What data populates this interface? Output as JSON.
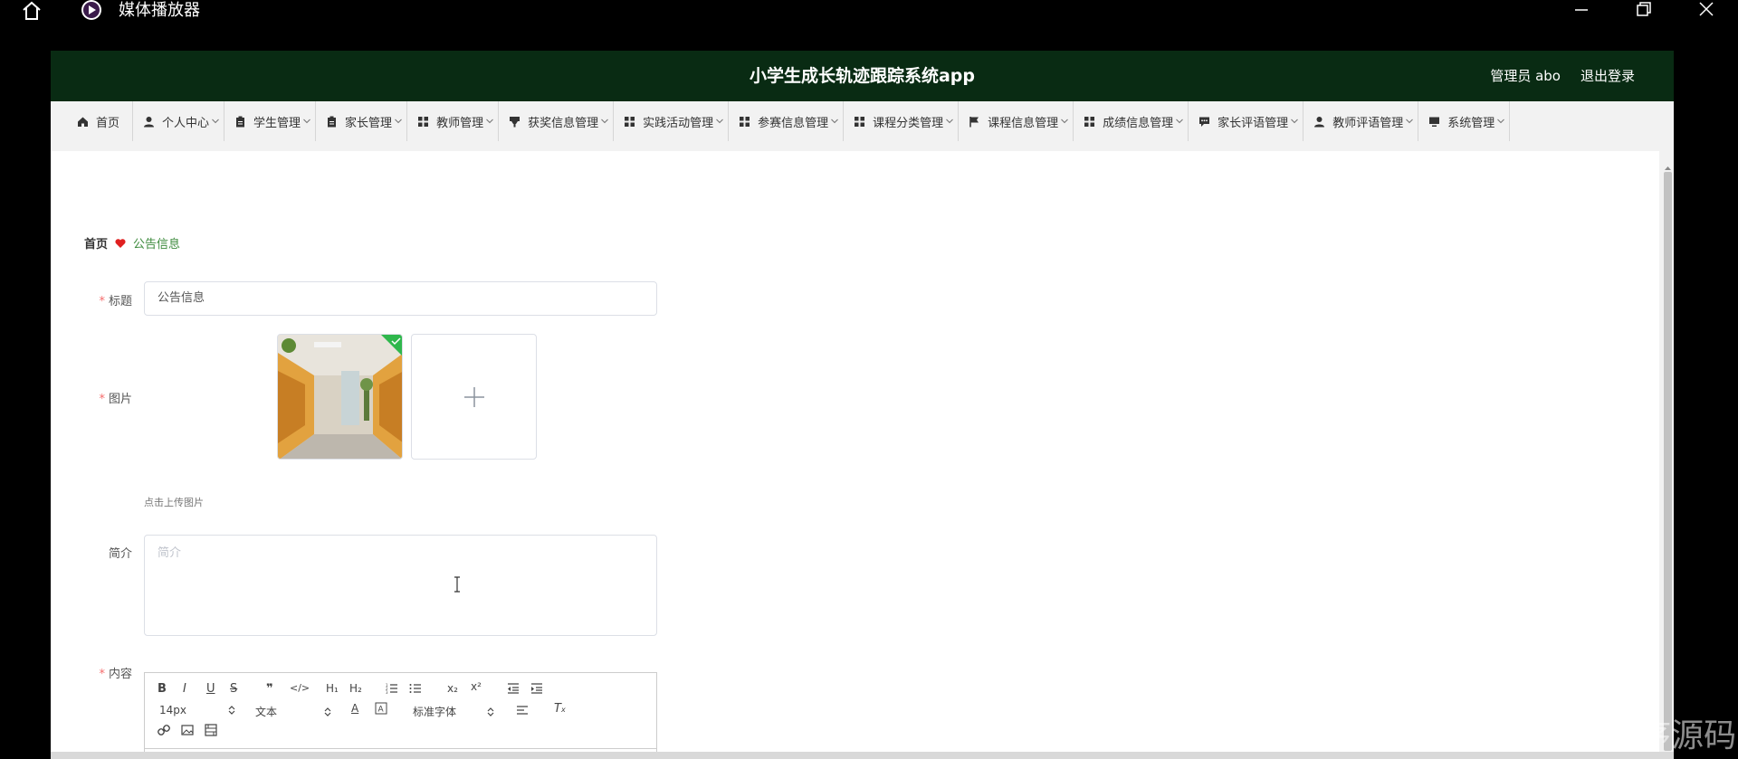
{
  "os": {
    "window_title": "媒体播放器"
  },
  "header": {
    "app_title": "小学生成长轨迹跟踪系统app",
    "user": "管理员 abo",
    "logout": "退出登录",
    "bg_color": "#092b13"
  },
  "nav": {
    "items": [
      {
        "label": "首页",
        "icon": "home-icon"
      },
      {
        "label": "个人中心",
        "icon": "user-icon"
      },
      {
        "label": "学生管理",
        "icon": "clipboard-icon"
      },
      {
        "label": "家长管理",
        "icon": "clipboard-icon"
      },
      {
        "label": "教师管理",
        "icon": "grid-icon"
      },
      {
        "label": "获奖信息管理",
        "icon": "trophy-icon"
      },
      {
        "label": "实践活动管理",
        "icon": "grid-icon"
      },
      {
        "label": "参赛信息管理",
        "icon": "grid-icon"
      },
      {
        "label": "课程分类管理",
        "icon": "grid-icon"
      },
      {
        "label": "课程信息管理",
        "icon": "flag-icon"
      },
      {
        "label": "成绩信息管理",
        "icon": "grid-icon"
      },
      {
        "label": "家长评语管理",
        "icon": "comment-icon"
      },
      {
        "label": "教师评语管理",
        "icon": "user-icon"
      },
      {
        "label": "系统管理",
        "icon": "monitor-icon"
      }
    ]
  },
  "breadcrumb": {
    "home": "首页",
    "current": "公告信息"
  },
  "form": {
    "title_label": "标题",
    "title_value": "公告信息",
    "image_label": "图片",
    "upload_hint": "点击上传图片",
    "intro_label": "简介",
    "intro_placeholder": "简介",
    "content_label": "内容"
  },
  "editor": {
    "font_size": "14px",
    "text_type": "文本",
    "font_family": "标准字体",
    "tools": [
      "bold-icon",
      "italic-icon",
      "underline-icon",
      "strike-icon",
      "quote-icon",
      "code-icon",
      "h1-icon",
      "h2-icon",
      "ordered-list-icon",
      "bullet-list-icon",
      "subscript-icon",
      "superscript-icon",
      "outdent-icon",
      "indent-icon",
      "font-color-icon",
      "bg-color-icon",
      "align-icon",
      "clear-format-icon",
      "link-icon",
      "image-icon",
      "video-icon"
    ]
  },
  "watermark": "CSDN @战少程序源码"
}
